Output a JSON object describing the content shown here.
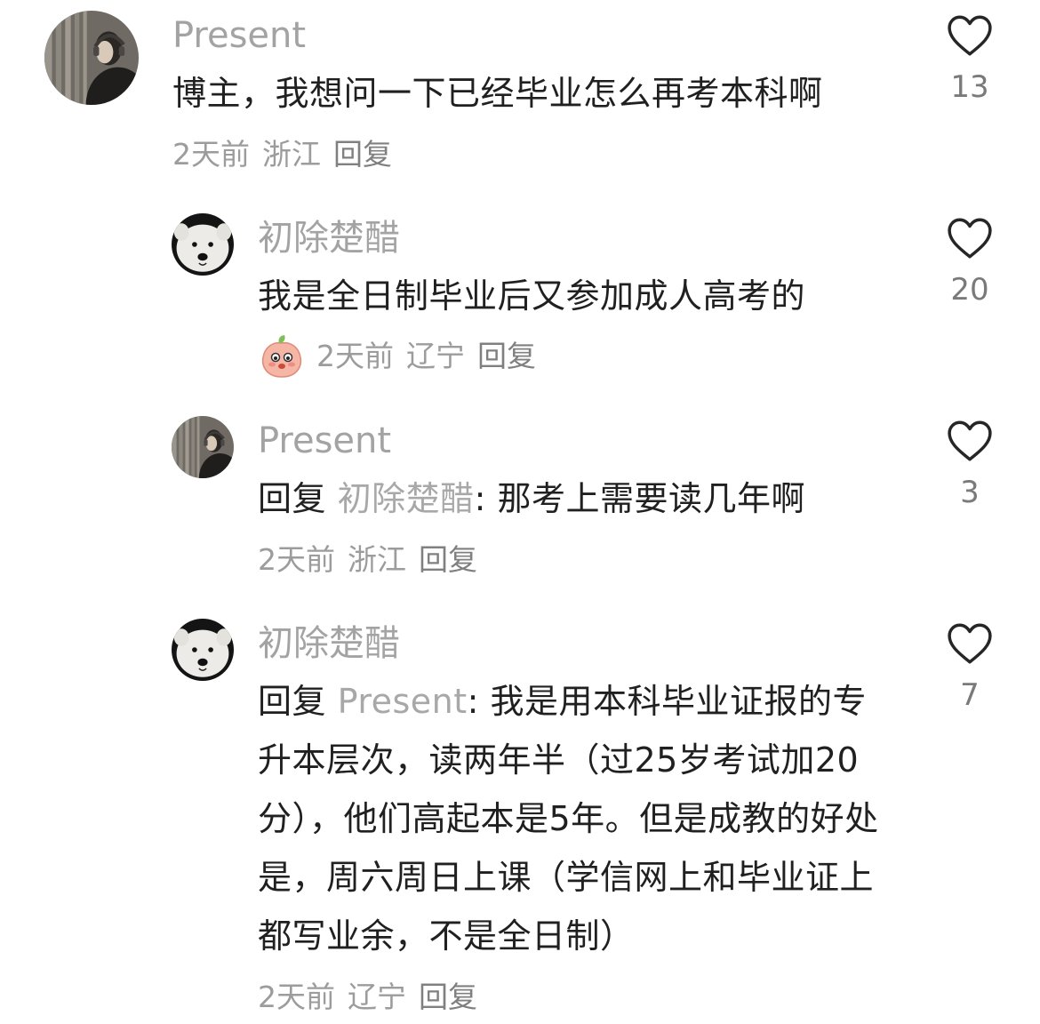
{
  "comments": [
    {
      "author": "Present",
      "avatar": "woman-headphones-avatar",
      "text": "博主，我想问一下已经毕业怎么再考本科啊",
      "time": "2天前",
      "location": "浙江",
      "reply_label": "回复",
      "likes": "13"
    },
    {
      "author": "初除楚醋",
      "avatar": "white-dog-avatar",
      "text": "我是全日制毕业后又参加成人高考的",
      "sticker": "peach-sticker",
      "time": "2天前",
      "location": "辽宁",
      "reply_label": "回复",
      "likes": "20"
    },
    {
      "author": "Present",
      "avatar": "woman-headphones-avatar",
      "reply_prefix": "回复 ",
      "reply_to": "初除楚醋",
      "text": ": 那考上需要读几年啊",
      "time": "2天前",
      "location": "浙江",
      "reply_label": "回复",
      "likes": "3"
    },
    {
      "author": "初除楚醋",
      "avatar": "white-dog-avatar",
      "reply_prefix": "回复 ",
      "reply_to": "Present",
      "text": ": 我是用本科毕业证报的专升本层次，读两年半（过25岁考试加20分），他们高起本是5年。但是成教的好处是，周六周日上课（学信网上和毕业证上都写业余，不是全日制）",
      "time": "2天前",
      "location": "辽宁",
      "reply_label": "回复",
      "likes": "7"
    }
  ]
}
